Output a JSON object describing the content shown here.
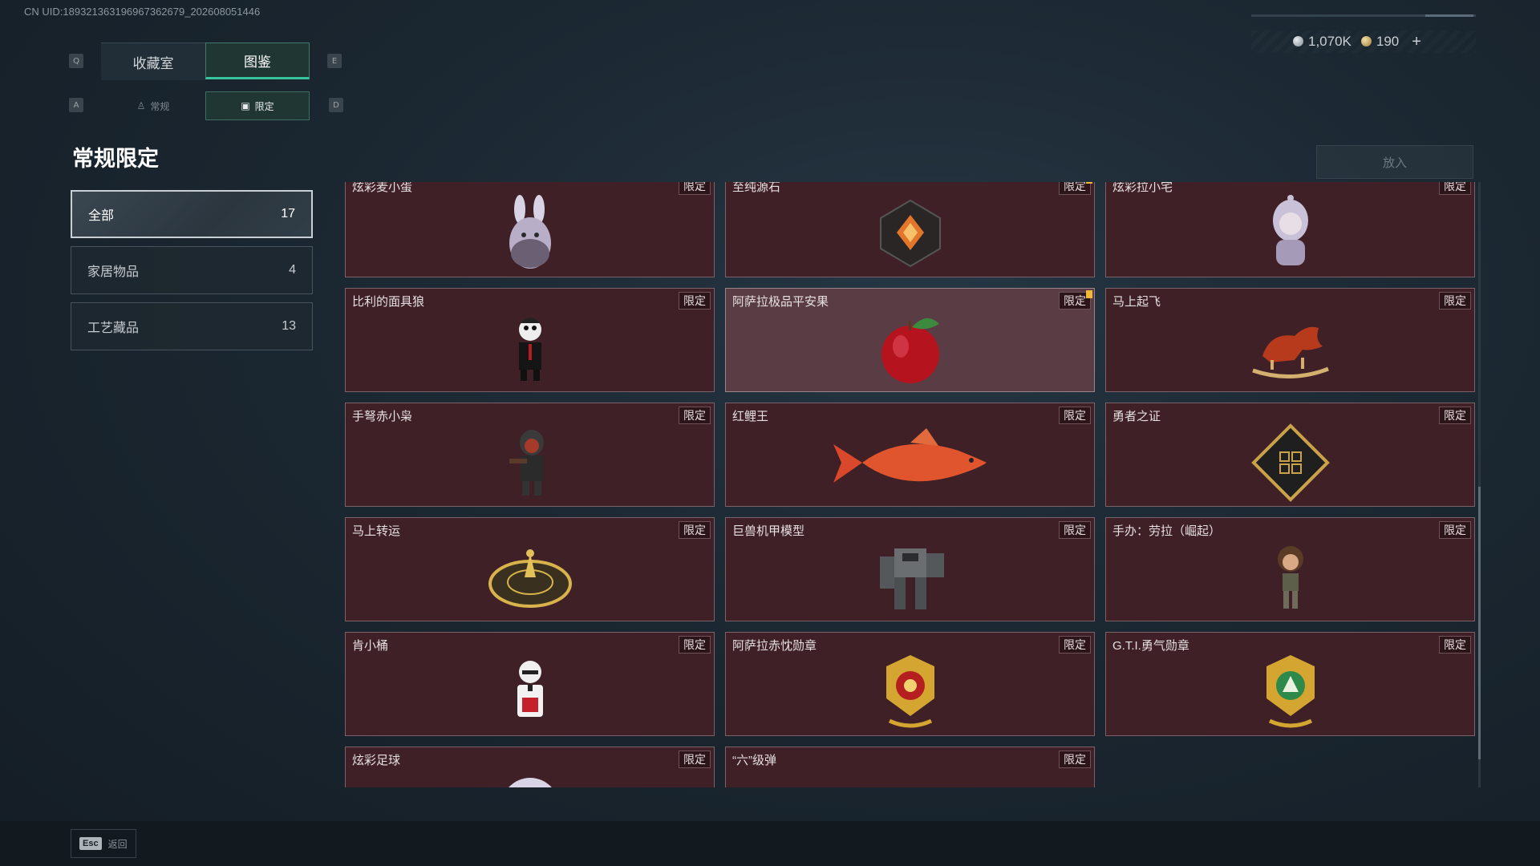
{
  "uid": "CN UID:18932136319696736267​9_202608051446",
  "header": {
    "key_left": "Q",
    "key_right": "E",
    "tabs": [
      {
        "label": "收藏室",
        "active": false
      },
      {
        "label": "图鉴",
        "active": true
      }
    ],
    "subkey_left": "A",
    "subkey_right": "D",
    "subtabs": [
      {
        "label": "常规",
        "icon": "figure-icon",
        "active": false
      },
      {
        "label": "限定",
        "icon": "image-icon",
        "active": true
      }
    ]
  },
  "currency": {
    "silver": "1,070K",
    "gold": "190",
    "add": "+"
  },
  "page_title": "常规限定",
  "put_button": "放入",
  "categories": [
    {
      "label": "全部",
      "count": "17",
      "active": true
    },
    {
      "label": "家居物品",
      "count": "4",
      "active": false
    },
    {
      "label": "工艺藏品",
      "count": "13",
      "active": false
    }
  ],
  "badge": "限定",
  "items": [
    {
      "name": "炫彩麦小蛋",
      "icon": "egg-bunny-icon"
    },
    {
      "name": "至纯源石",
      "icon": "crystal-icon",
      "flag": true
    },
    {
      "name": "炫彩拉小宅",
      "icon": "hooded-figure-icon"
    },
    {
      "name": "比利的面具狼",
      "icon": "puppet-figure-icon"
    },
    {
      "name": "阿萨拉极品平安果",
      "icon": "apple-icon",
      "flag": true,
      "highlight": true
    },
    {
      "name": "马上起飞",
      "icon": "rocking-horse-icon"
    },
    {
      "name": "手弩赤小枭",
      "icon": "hooded-soldier-icon"
    },
    {
      "name": "红鲤王",
      "icon": "carp-icon"
    },
    {
      "name": "勇者之证",
      "icon": "diamond-plaque-icon"
    },
    {
      "name": "马上转运",
      "icon": "golden-wheel-icon"
    },
    {
      "name": "巨兽机甲模型",
      "icon": "mech-icon"
    },
    {
      "name": "手办：劳拉（崛起）",
      "icon": "lara-figure-icon"
    },
    {
      "name": "肯小桶",
      "icon": "colonel-figure-icon"
    },
    {
      "name": "阿萨拉赤忱勋章",
      "icon": "red-medal-icon"
    },
    {
      "name": "G.T.I.勇气勋章",
      "icon": "green-medal-icon"
    },
    {
      "name": "炫彩足球",
      "icon": "football-icon"
    },
    {
      "name": "“六”级弹",
      "icon": "shell-icon"
    }
  ],
  "footer": {
    "key": "Esc",
    "label": "返回"
  }
}
